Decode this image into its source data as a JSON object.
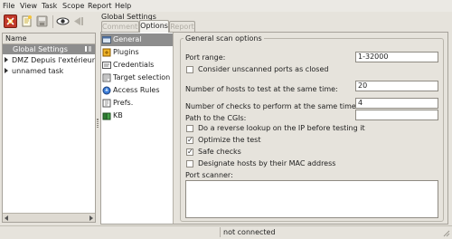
{
  "menu": [
    "File",
    "View",
    "Task",
    "Scope",
    "Report",
    "Help"
  ],
  "toolbar": {
    "icons": [
      "new-task-icon",
      "new-scope-icon",
      "save-icon",
      "scan-icon",
      "stop-icon"
    ]
  },
  "tree": {
    "header": "Name",
    "items": [
      {
        "label": "Global Settings",
        "selected": true,
        "expandable": false
      },
      {
        "label": "DMZ Depuis l'extérieur",
        "selected": false,
        "expandable": true
      },
      {
        "label": "unnamed task",
        "selected": false,
        "expandable": true
      }
    ]
  },
  "panel": {
    "title": "Global Settings",
    "tabs": [
      {
        "label": "Comments",
        "active": false,
        "enabled": false
      },
      {
        "label": "Options",
        "active": true,
        "enabled": true
      },
      {
        "label": "Report",
        "active": false,
        "enabled": false
      }
    ]
  },
  "categories": [
    {
      "label": "General",
      "icon": "general-icon",
      "selected": true
    },
    {
      "label": "Plugins",
      "icon": "plugins-icon",
      "selected": false
    },
    {
      "label": "Credentials",
      "icon": "credentials-icon",
      "selected": false
    },
    {
      "label": "Target selection",
      "icon": "target-icon",
      "selected": false
    },
    {
      "label": "Access Rules",
      "icon": "access-rules-icon",
      "selected": false
    },
    {
      "label": "Prefs.",
      "icon": "prefs-icon",
      "selected": false
    },
    {
      "label": "KB",
      "icon": "kb-icon",
      "selected": false
    }
  ],
  "general": {
    "frame_title": "General scan options",
    "port_range_label": "Port range:",
    "port_range_value": "1-32000",
    "consider_unscanned_label": "Consider unscanned ports as closed",
    "consider_unscanned_checked": false,
    "hosts_label": "Number of hosts to test at the same time:",
    "hosts_value": "20",
    "checks_label": "Number of checks to perform at the same time:",
    "checks_value": "4",
    "cgi_label": "Path to the CGIs:",
    "cgi_value": "",
    "reverse_lookup_label": "Do a reverse lookup on the IP before testing it",
    "reverse_lookup_checked": false,
    "optimize_label": "Optimize the test",
    "optimize_checked": true,
    "safe_checks_label": "Safe checks",
    "safe_checks_checked": true,
    "designate_mac_label": "Designate hosts by their MAC address",
    "designate_mac_checked": false,
    "port_scanner_label": "Port scanner:"
  },
  "status": {
    "text": "not connected"
  },
  "colors": {
    "selection": "#8d8d8d",
    "background": "#e6e3dc"
  }
}
